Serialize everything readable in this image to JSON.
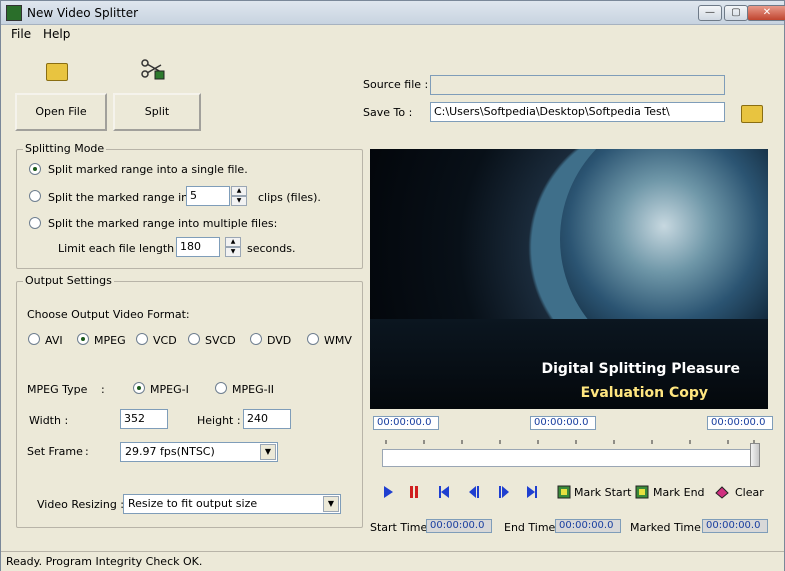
{
  "window": {
    "title": "New Video Splitter"
  },
  "menu": [
    "File",
    "Help"
  ],
  "toolbar": {
    "open_label": "Open File",
    "split_label": "Split"
  },
  "source_file_label": "Source file :",
  "source_file_value": "",
  "save_to_label": "Save To :",
  "save_to_value": "C:\\Users\\Softpedia\\Desktop\\Softpedia Test\\",
  "splitting_mode": {
    "caption": "Splitting Mode",
    "option1": "Split marked range into a single file.",
    "option2_pre": "Split the marked range into",
    "option2_value": "5",
    "option2_post": "clips (files).",
    "option3": "Split the marked range into multiple files:",
    "limit_pre": "Limit each file length to",
    "limit_value": "180",
    "limit_post": "seconds."
  },
  "output": {
    "caption": "Output Settings",
    "format_label": "Choose Output Video Format:",
    "formats": [
      "AVI",
      "MPEG",
      "VCD",
      "SVCD",
      "DVD",
      "WMV"
    ],
    "selected_format": "MPEG",
    "mpeg_type_label": "MPEG Type",
    "mpeg_type_colon": ":",
    "mpeg1": "MPEG-I",
    "mpeg2": "MPEG-II",
    "width_label": "Width :",
    "width_value": "352",
    "height_label": "Height :",
    "height_value": "240",
    "frame_label": "Set Frame",
    "frame_colon": ":",
    "frame_value": "29.97 fps(NTSC)",
    "resize_label": "Video Resizing :",
    "resize_value": "Resize to fit output size"
  },
  "video": {
    "line1": "Digital Splitting Pleasure",
    "line2": "Evaluation Copy"
  },
  "times": {
    "left": "00:00:00.0",
    "center": "00:00:00.0",
    "right": "00:00:00.0"
  },
  "controls": {
    "mark_start": "Mark Start",
    "mark_end": "Mark End",
    "clear": "Clear"
  },
  "bottom": {
    "start_label": "Start Time:",
    "start_value": "00:00:00.0",
    "end_label": "End Time:",
    "end_value": "00:00:00.0",
    "marked_label": "Marked Time:",
    "marked_value": "00:00:00.0"
  },
  "status": "Ready. Program Integrity Check OK."
}
